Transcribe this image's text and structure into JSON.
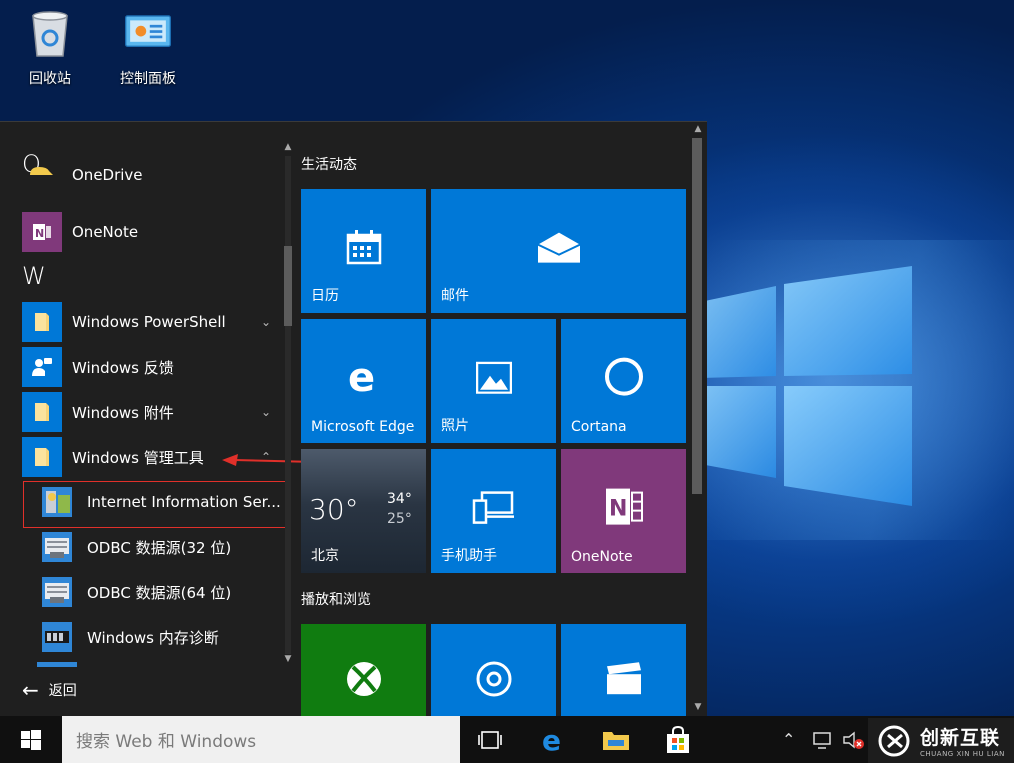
{
  "desktop": {
    "icons": [
      {
        "label": "回收站",
        "icon": "recycle-bin-icon"
      },
      {
        "label": "控制面板",
        "icon": "control-panel-icon"
      }
    ]
  },
  "start_menu": {
    "app_list": {
      "sections": [
        {
          "letter": "O"
        },
        {
          "letter": "W"
        }
      ],
      "items": [
        {
          "label": "OneDrive",
          "icon": "onedrive-icon"
        },
        {
          "label": "OneNote",
          "icon": "onenote-icon",
          "color": "#80397b"
        },
        {
          "label": "Windows PowerShell",
          "icon": "folder-icon",
          "expand": "chevron-down"
        },
        {
          "label": "Windows 反馈",
          "icon": "feedback-icon"
        },
        {
          "label": "Windows 附件",
          "icon": "folder-icon",
          "expand": "chevron-down"
        },
        {
          "label": "Windows 管理工具",
          "icon": "folder-icon",
          "expand": "chevron-up"
        },
        {
          "label": "Internet Information Ser...",
          "icon": "iis-icon"
        },
        {
          "label": "ODBC 数据源(32 位)",
          "icon": "odbc-icon"
        },
        {
          "label": "ODBC 数据源(64 位)",
          "icon": "odbc-icon"
        },
        {
          "label": "Windows 内存诊断",
          "icon": "memory-diagnostic-icon"
        }
      ],
      "back_label": "返回"
    },
    "groups": [
      {
        "title": "生活动态"
      },
      {
        "title": "播放和浏览"
      }
    ],
    "tiles": {
      "calendar": "日历",
      "mail": "邮件",
      "edge": "Microsoft Edge",
      "photos": "照片",
      "cortana": "Cortana",
      "weather": {
        "temp": "30°",
        "high": "34°",
        "low": "25°",
        "city": "北京"
      },
      "phone": "手机助手",
      "onenote": "OneNote"
    },
    "colors": {
      "tile_blue": "#0078d7",
      "onenote_purple": "#80397b",
      "xbox_green": "#107c10",
      "highlight_red": "#e0302a"
    }
  },
  "taskbar": {
    "search_placeholder": "搜索 Web 和 Windows",
    "brand_main": "创新互联",
    "brand_sub": "CHUANG XIN HU LIAN"
  }
}
